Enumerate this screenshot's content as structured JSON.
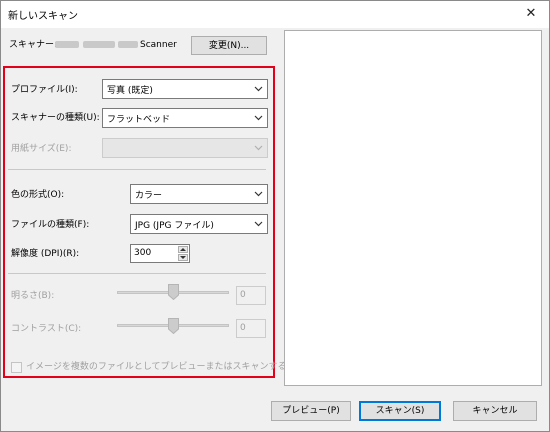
{
  "window": {
    "title": "新しいスキャン",
    "close_symbol": "✕"
  },
  "scanner": {
    "label": "スキャナー:",
    "name_suffix": "Scanner",
    "change_button": "変更(N)..."
  },
  "profile": {
    "label": "プロファイル(I):",
    "value": "写真 (既定)"
  },
  "source": {
    "label": "スキャナーの種類(U):",
    "value": "フラットベッド"
  },
  "paper_size": {
    "label": "用紙サイズ(E):",
    "value": ""
  },
  "color_format": {
    "label": "色の形式(O):",
    "value": "カラー"
  },
  "file_type": {
    "label": "ファイルの種類(F):",
    "value": "JPG (JPG ファイル)"
  },
  "resolution": {
    "label": "解像度 (DPI)(R):",
    "value": "300"
  },
  "brightness": {
    "label": "明るさ(B):",
    "value": "0",
    "level": 0.5
  },
  "contrast": {
    "label": "コントラスト(C):",
    "value": "0",
    "level": 0.5
  },
  "multi_file": {
    "label": "イメージを複数のファイルとしてプレビューまたはスキャンする(T)",
    "checked": false
  },
  "buttons": {
    "preview": "プレビュー(P)",
    "scan": "スキャン(S)",
    "cancel": "キャンセル"
  },
  "colors": {
    "highlight": "#e3001b",
    "default_button_border": "#0078d7"
  }
}
